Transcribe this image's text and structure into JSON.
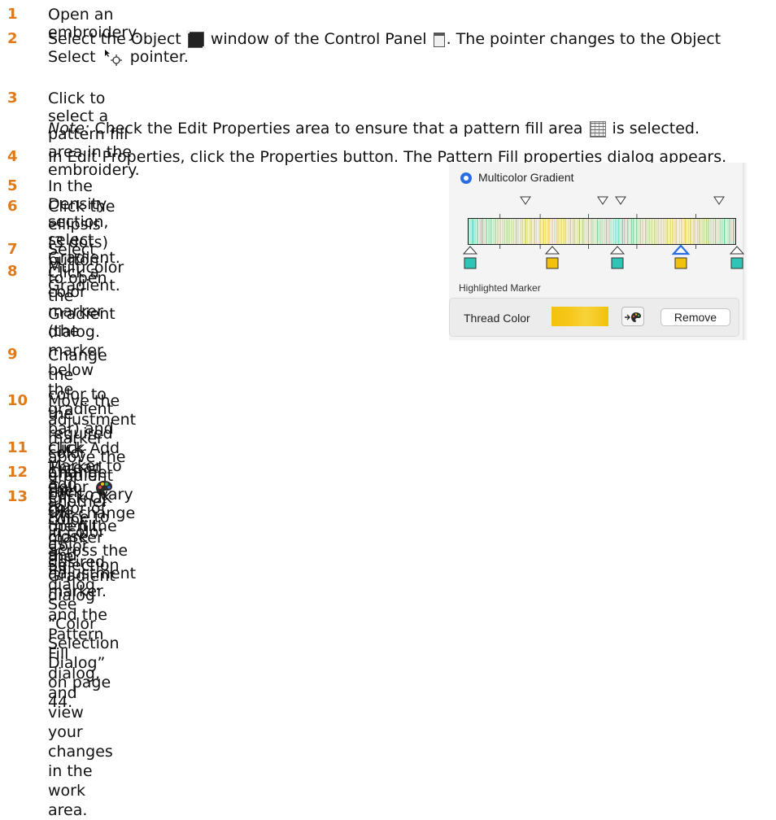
{
  "steps": [
    {
      "num": "1",
      "text": "Open an embroidery."
    },
    {
      "num": "2",
      "a": "Select the Object",
      "b": "window of the Control Panel",
      "c": ". The pointer changes to the Object",
      "d": "Select",
      "e": "pointer."
    },
    {
      "num": "3",
      "text": "Click to select a pattern fill area in the embroidery."
    },
    {
      "note_label": "Note:",
      "note_a": "Check the Edit Properties area to ensure that a pattern fill area",
      "note_b": "is selected."
    },
    {
      "num": "4",
      "text": "In Edit Properties, click the Properties button. The Pattern Fill properties dialog appears."
    },
    {
      "num": "5",
      "text": "In the Density section, select Gradient."
    },
    {
      "num": "6",
      "line1": "Click the ellipsis (3 dots) button to open the",
      "line2": "Gradient dialog."
    },
    {
      "num": "7",
      "text": "Select Multicolor Gradient."
    },
    {
      "num": "8",
      "line1": "Click a color marker (the marker below the",
      "line2a": "gradient bar) and click Thread Color",
      "line2b": "to",
      "line3": "open the Color Selection dialog. See “Color",
      "line4": "Selection Dialog” on page 44."
    },
    {
      "num": "9",
      "line1": "Change the color to the required color and",
      "line2": "click OK."
    },
    {
      "num": "10",
      "line1": "Move the adjustment marker above the gradient bar to vary the change in color across the",
      "line2": "fill."
    },
    {
      "num": "11",
      "text": "Click Add Marker to add another color marker and adjustment marker."
    },
    {
      "num": "12",
      "text": "Change the color of the fill as desired."
    },
    {
      "num": "13",
      "line1": "Click OK twice to close the Gradient dialog and the Pattern Fill dialog, and view your",
      "line2": "changes in the work area."
    }
  ],
  "icons": {
    "object": "object-select-icon",
    "control_panel": "control-panel-icon",
    "pointer": "object-select-pointer-icon",
    "pattern_fill": "pattern-fill-icon",
    "thread_color": "thread-color-palette-icon"
  },
  "dialog": {
    "radio_label": "Multicolor Gradient",
    "highlighted_marker_label": "Highlighted Marker",
    "thread_color_label": "Thread Color",
    "remove_button": "Remove",
    "marker_count": 5,
    "colors": {
      "teal": "#2ec4b6",
      "yellow": "#f2c10d",
      "accent_blue": "#2a6ce6",
      "step_number": "#e07a18"
    }
  }
}
